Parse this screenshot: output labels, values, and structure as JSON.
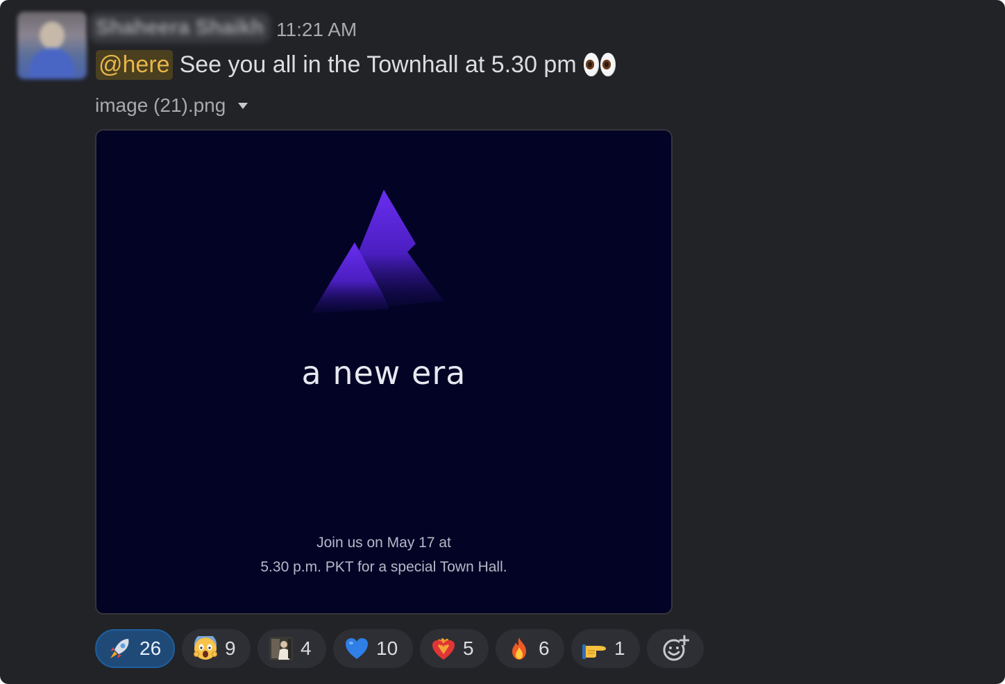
{
  "message": {
    "username": "Shaheera Shaikh",
    "timestamp": "11:21 AM",
    "mention": "@here",
    "text": "See you all in the Townhall at 5.30 pm",
    "trailing_emoji": "eyes-emoji"
  },
  "attachment": {
    "filename": "image (21).png",
    "image": {
      "tagline": "a new era",
      "invite_line1": "Join us on May 17 at",
      "invite_line2": "5.30 p.m. PKT for a special Town Hall.",
      "background_color": "#030326",
      "logo_color_top": "#6a2ef0",
      "logo_color_bottom": "#1a0d5c"
    }
  },
  "reactions": [
    {
      "emoji": "rocket-emoji",
      "count": "26",
      "active": true
    },
    {
      "emoji": "screaming-face-emoji",
      "count": "9",
      "active": false
    },
    {
      "emoji": "custom-person-emoji",
      "count": "4",
      "active": false
    },
    {
      "emoji": "blue-heart-emoji",
      "count": "10",
      "active": false
    },
    {
      "emoji": "heart-on-fire-emoji",
      "count": "5",
      "active": false
    },
    {
      "emoji": "fire-emoji",
      "count": "6",
      "active": false
    },
    {
      "emoji": "pointing-hand-emoji",
      "count": "1",
      "active": false
    }
  ],
  "colors": {
    "background": "#222327",
    "mention_bg": "#4a3f1f",
    "mention_text": "#e8b64a",
    "active_reaction": "#1f4a78"
  }
}
